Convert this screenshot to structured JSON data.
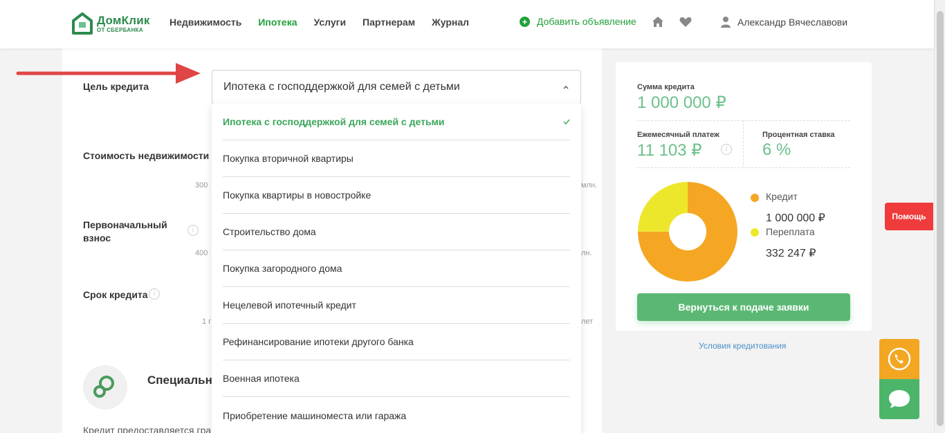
{
  "header": {
    "logo": {
      "name": "ДомКлик",
      "sub": "ОТ СБЕРБАНКА"
    },
    "nav": [
      {
        "label": "Недвижимость",
        "active": false
      },
      {
        "label": "Ипотека",
        "active": true
      },
      {
        "label": "Услуги",
        "active": false
      },
      {
        "label": "Партнерам",
        "active": false
      },
      {
        "label": "Журнал",
        "active": false
      }
    ],
    "add_ad_label": "Добавить объявление",
    "user_name": "Александр Вячеславови"
  },
  "form": {
    "goal_label": "Цель кредита",
    "goal_selected": "Ипотека с господдержкой для семей с детьми",
    "property_cost_label": "Стоимость недвижимости",
    "property_min": "300",
    "property_max_unit": "млн.",
    "down_payment_label": "Первоначальный взнос",
    "down_min": "400",
    "down_max_unit": "лн.",
    "term_label": "Срок кредита",
    "term_min": "1 г",
    "term_max_unit": "лет",
    "special_title": "Специальн «Ипотека с",
    "credit_note": "Кредит предоставляется гра"
  },
  "dropdown_options": [
    {
      "label": "Ипотека с господдержкой для семей с детьми",
      "selected": true
    },
    {
      "label": "Покупка вторичной квартиры",
      "selected": false
    },
    {
      "label": "Покупка квартиры в новостройке",
      "selected": false
    },
    {
      "label": "Строительство дома",
      "selected": false
    },
    {
      "label": "Покупка загородного дома",
      "selected": false
    },
    {
      "label": "Нецелевой ипотечный кредит",
      "selected": false
    },
    {
      "label": "Рефинансирование ипотеки другого банка",
      "selected": false
    },
    {
      "label": "Военная ипотека",
      "selected": false
    },
    {
      "label": "Приобретение машиноместа или гаража",
      "selected": false
    }
  ],
  "summary": {
    "loan_amount_label": "Сумма кредита",
    "loan_amount": "1 000 000 ₽",
    "monthly_payment_label": "Ежемесячный платеж",
    "monthly_payment": "11 103 ₽",
    "rate_label": "Процентная ставка",
    "rate": "6 %",
    "legend_credit_label": "Кредит",
    "legend_credit_value": "1 000 000 ₽",
    "legend_overpay_label": "Переплата",
    "legend_overpay_value": "332 247 ₽",
    "return_button": "Вернуться к подаче заявки",
    "terms_link": "Условия кредитования"
  },
  "chart_data": {
    "type": "pie",
    "categories": [
      "Кредит",
      "Переплата"
    ],
    "values": [
      1000000,
      332247
    ],
    "colors": [
      "#f5a623",
      "#ede72c"
    ]
  },
  "help_label": "Помощь",
  "colors": {
    "brand_green": "#21a038",
    "accent_orange": "#f2a621",
    "help_red": "#ef3b3b"
  }
}
